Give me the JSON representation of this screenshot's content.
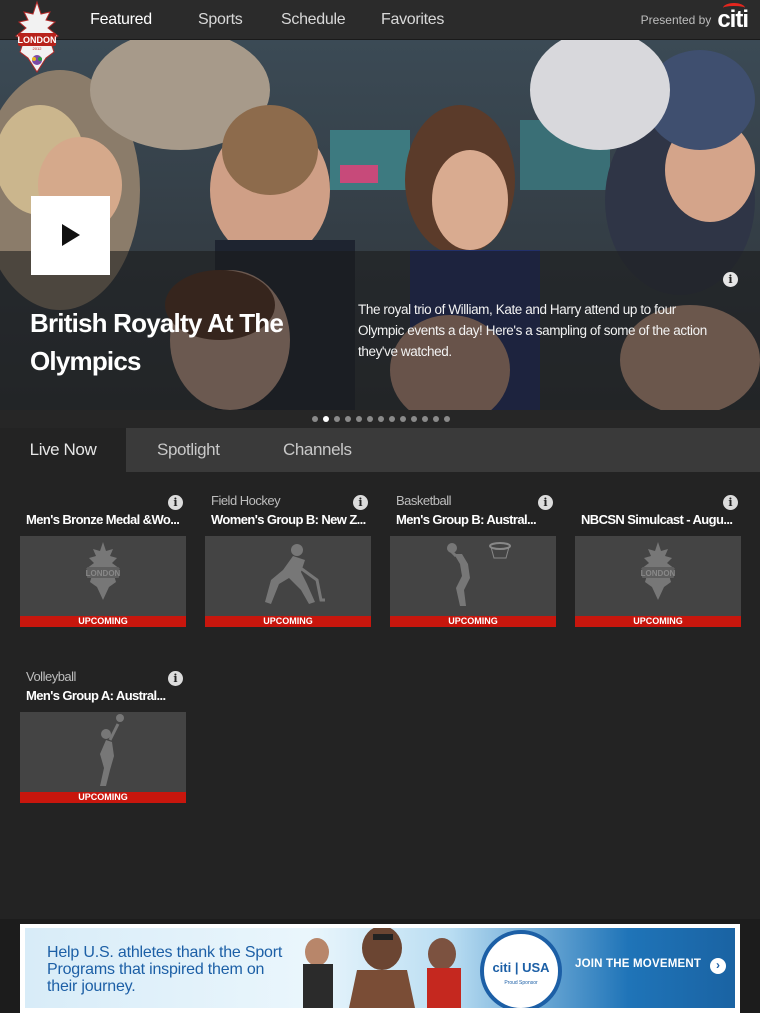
{
  "header": {
    "logo_text": "LONDON",
    "tabs": [
      {
        "label": "Featured",
        "active": true
      },
      {
        "label": "Sports",
        "active": false
      },
      {
        "label": "Schedule",
        "active": false
      },
      {
        "label": "Favorites",
        "active": false
      }
    ],
    "presented_label": "Presented by",
    "sponsor_logo": "citi"
  },
  "hero": {
    "title": "British Royalty At The Olympics",
    "description": "The royal trio of William, Kate and Harry attend up to four Olympic events a day! Here's a sampling of some of the action they've watched.",
    "play_icon": "play-icon",
    "info_icon": "info-icon",
    "pager": {
      "total": 13,
      "active_index": 1
    }
  },
  "subtabs": [
    {
      "label": "Live Now",
      "active": true
    },
    {
      "label": "Spotlight",
      "active": false
    },
    {
      "label": "Channels",
      "active": false
    }
  ],
  "events": [
    {
      "sport": "",
      "title": "Men's Bronze Medal &Wo...",
      "status": "UPCOMING",
      "thumb": "london-2012-logo"
    },
    {
      "sport": "Field Hockey",
      "title": "Women's Group B: New Z...",
      "status": "UPCOMING",
      "thumb": "field-hockey-icon"
    },
    {
      "sport": "Basketball",
      "title": "Men's Group B: Austral...",
      "status": "UPCOMING",
      "thumb": "basketball-icon"
    },
    {
      "sport": "",
      "title": "NBCSN Simulcast - Augu...",
      "status": "UPCOMING",
      "thumb": "london-2012-logo"
    },
    {
      "sport": "Volleyball",
      "title": "Men's Group A: Austral...",
      "status": "UPCOMING",
      "thumb": "volleyball-icon"
    }
  ],
  "ad": {
    "text": "Help U.S. athletes thank the Sport Programs that inspired them on their journey.",
    "seal_label": "citi | USA",
    "seal_sub": "Proud Sponsor",
    "cta": "JOIN THE MOVEMENT"
  },
  "colors": {
    "accent": "#1b8fd6",
    "status_red": "#c8160d",
    "background": "#232323"
  }
}
